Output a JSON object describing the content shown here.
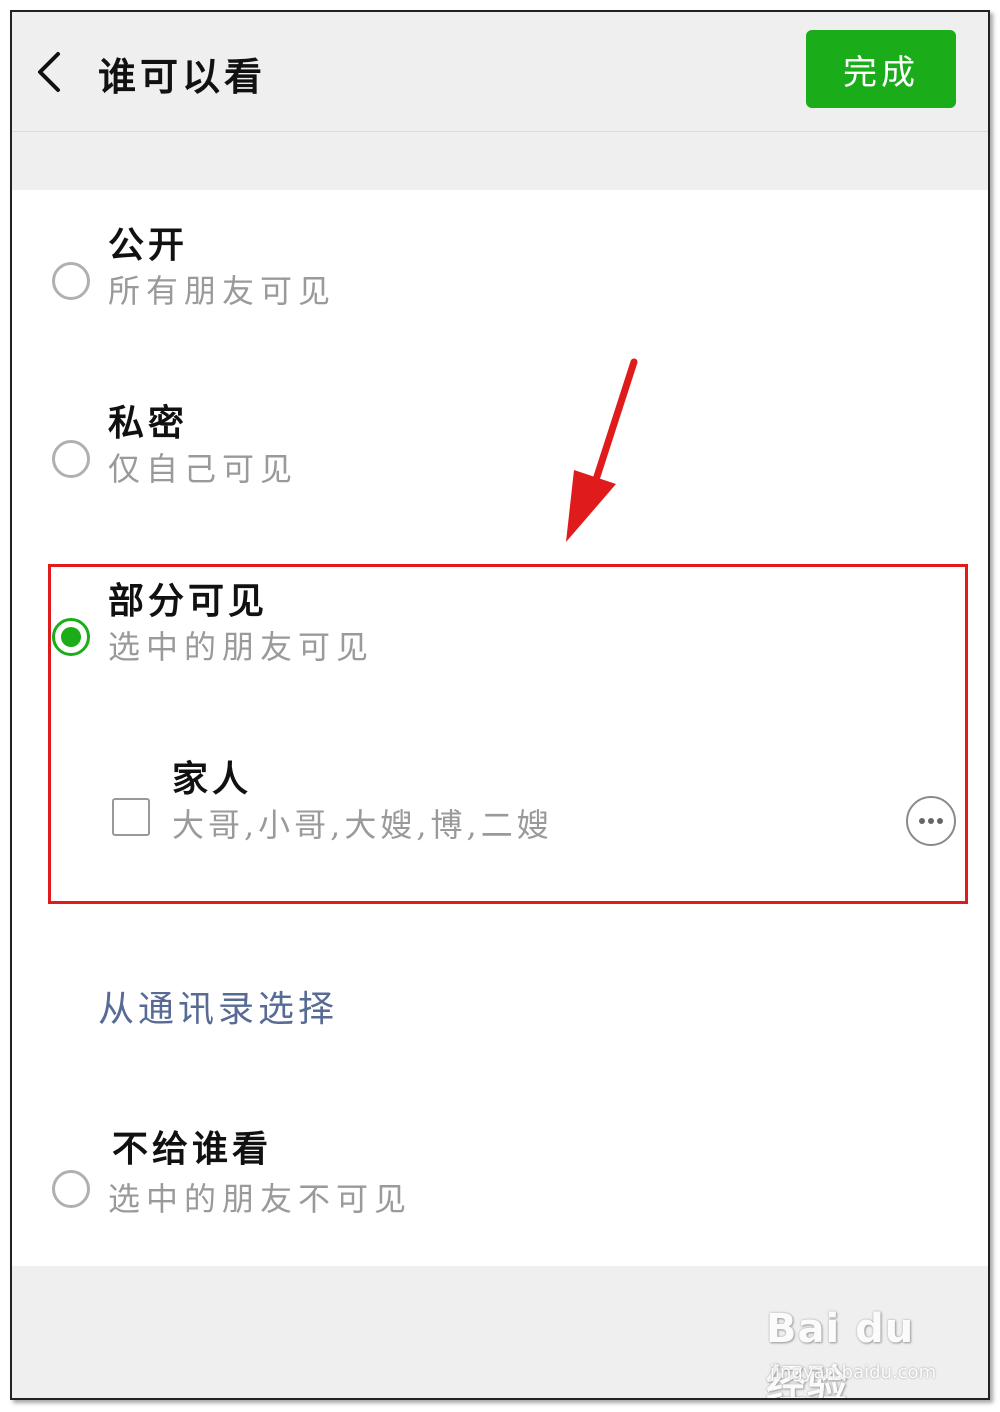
{
  "header": {
    "title": "谁可以看",
    "done_label": "完成",
    "back_icon": "chevron-left-icon",
    "done_color": "#1aad19"
  },
  "options": [
    {
      "title": "公开",
      "subtitle": "所有朋友可见",
      "selected": false
    },
    {
      "title": "私密",
      "subtitle": "仅自己可见",
      "selected": false
    },
    {
      "title": "部分可见",
      "subtitle": "选中的朋友可见",
      "selected": true
    },
    {
      "title": "不给谁看",
      "subtitle": "选中的朋友不可见",
      "selected": false
    }
  ],
  "tag_group": {
    "name": "家人",
    "members": "大哥,小哥,大嫂,博,二嫂",
    "checked": false,
    "more_icon": "ellipsis-circle-icon"
  },
  "contacts_link": "从通讯录选择",
  "annotation": {
    "color": "#e01b1b",
    "arrow_icon": "red-arrow-icon"
  },
  "watermark": {
    "logo": "Bai du 经验",
    "url": "jingyan.baidu.com"
  },
  "colors": {
    "accent": "#1aad19",
    "link": "#576b95",
    "background": "#efefef"
  }
}
